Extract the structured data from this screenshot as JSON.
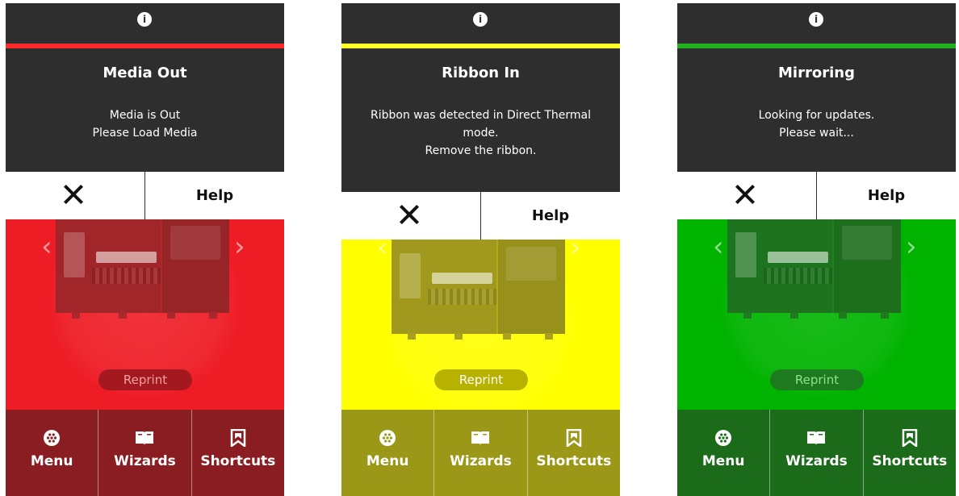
{
  "panels": [
    {
      "status_title": "Media Out",
      "message_lines": [
        "Media is Out",
        "Please Load Media"
      ],
      "help_label": "Help",
      "reprint_label": "Reprint",
      "nav": {
        "menu": "Menu",
        "wizards": "Wizards",
        "shortcuts": "Shortcuts"
      },
      "info_icon": "i",
      "colors": {
        "stripe": "#ff2a2a",
        "bg": "#ee1c25",
        "bottom": "#8a1d21",
        "reprint_bg": "#a3191f",
        "reprint_text": "#f5a0a0",
        "printer": "#a8282b"
      }
    },
    {
      "status_title": "Ribbon In",
      "message_lines": [
        "Ribbon was detected in Direct Thermal",
        "mode.",
        "Remove the ribbon."
      ],
      "help_label": "Help",
      "reprint_label": "Reprint",
      "nav": {
        "menu": "Menu",
        "wizards": "Wizards",
        "shortcuts": "Shortcuts"
      },
      "info_icon": "i",
      "colors": {
        "stripe": "#ffff2a",
        "bg": "#ffff00",
        "bottom": "#9c9817",
        "reprint_bg": "#b7b200",
        "reprint_text": "#ffffff",
        "printer": "#a8a11f"
      }
    },
    {
      "status_title": "Mirroring",
      "message_lines": [
        "Looking for updates.",
        "Please wait..."
      ],
      "help_label": "Help",
      "reprint_label": "Reprint",
      "nav": {
        "menu": "Menu",
        "wizards": "Wizards",
        "shortcuts": "Shortcuts"
      },
      "info_icon": "i",
      "colors": {
        "stripe": "#22b022",
        "bg": "#00b300",
        "bottom": "#1b6b1b",
        "reprint_bg": "#1e7a1e",
        "reprint_text": "#8fe08f",
        "printer": "#207a20"
      }
    }
  ]
}
